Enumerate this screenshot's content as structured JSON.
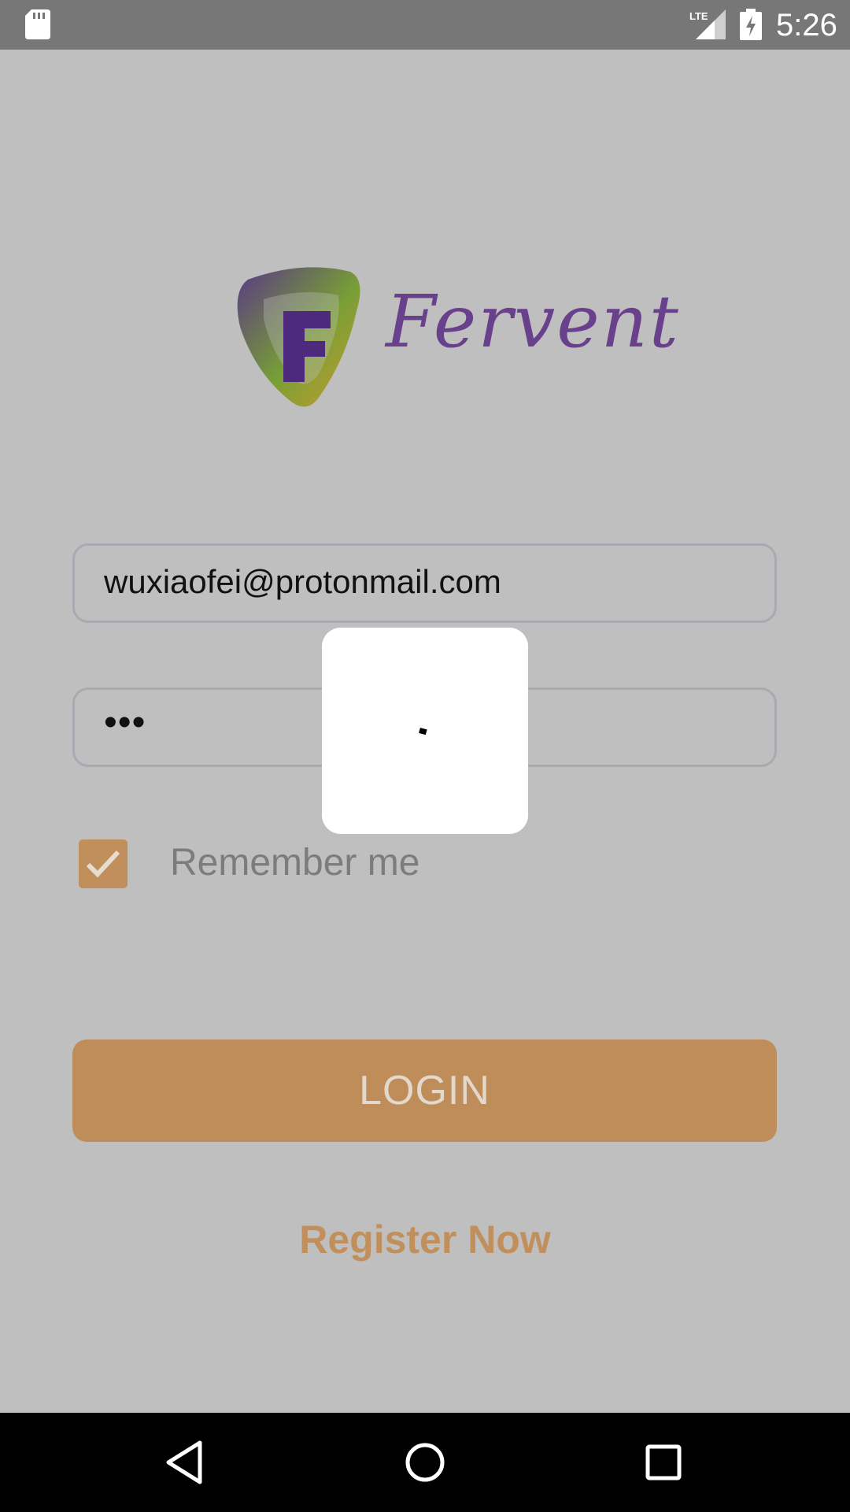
{
  "status_bar": {
    "time": "5:26",
    "network": "LTE",
    "icons": [
      "sd-card-icon",
      "lte-signal-icon",
      "battery-charging-icon"
    ]
  },
  "logo": {
    "brand_text": "Fervent",
    "colors": {
      "purple": "#5b2a82",
      "green": "#6f9a26",
      "gold": "#c99a1e"
    }
  },
  "login_form": {
    "email": "wuxiaofei@protonmail.com",
    "password_masked": "•••",
    "remember_me": {
      "label": "Remember me",
      "checked": true
    },
    "login_label": "LOGIN",
    "register_label": "Register Now"
  },
  "loading_dialog": {
    "icon": "spinner-icon"
  },
  "nav_bar": {
    "icons": [
      "back-icon",
      "home-icon",
      "recent-apps-icon"
    ]
  },
  "colors": {
    "accent": "#c08f5b",
    "overlay_background": "#bfbfbf",
    "status_bar": "#777777",
    "nav_bar": "#000000"
  }
}
